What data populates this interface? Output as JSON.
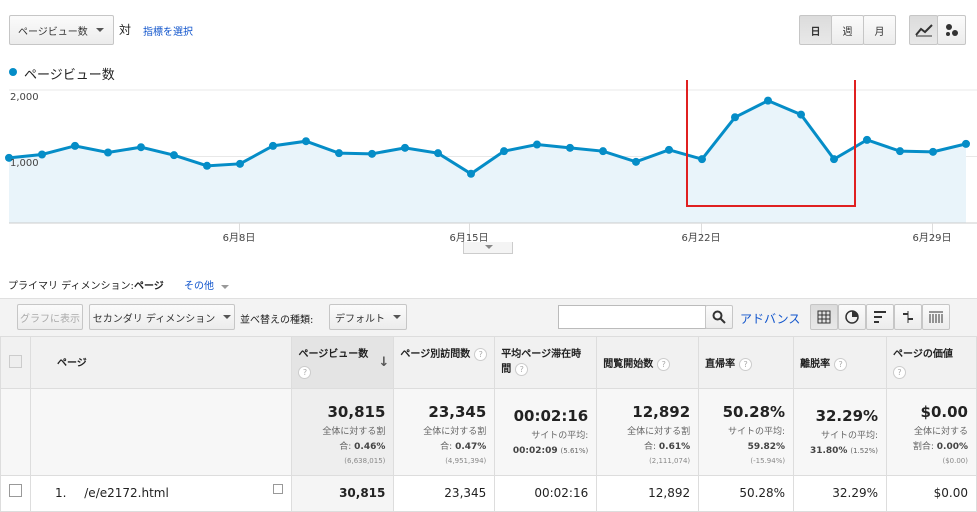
{
  "toolbar": {
    "metric_select": "ページビュー数",
    "vs_label": "対",
    "select_metric_link": "指標を選択",
    "period": {
      "day": "日",
      "week": "週",
      "month": "月"
    }
  },
  "legend": {
    "series": "ページビュー数",
    "color": "#058dc7"
  },
  "chart_data": {
    "type": "area",
    "title": "",
    "series": [
      {
        "name": "ページビュー数",
        "values": [
          980,
          1030,
          1160,
          1060,
          1140,
          1020,
          860,
          890,
          1160,
          1230,
          1050,
          1040,
          1130,
          1050,
          740,
          1080,
          1180,
          1130,
          1080,
          920,
          1100,
          960,
          1590,
          1840,
          1630,
          960,
          1250,
          1080,
          1070,
          1190
        ]
      }
    ],
    "ylim": [
      0,
      2000
    ],
    "y_ticks": [
      "2,000",
      "1,000"
    ],
    "x_ticks": [
      "6月8日",
      "6月15日",
      "6月22日",
      "6月29日"
    ],
    "grid": true,
    "highlight_label": "red box around peak"
  },
  "dimension": {
    "label": "プライマリ ディメンション:",
    "selected": "ページ",
    "other": "その他"
  },
  "controls": {
    "plot_rows": "グラフに表示",
    "secondary_dimension": "セカンダリ ディメンション",
    "sort_label": "並べ替えの種類:",
    "sort_value": "デフォルト",
    "search_placeholder": "",
    "advanced": "アドバンス"
  },
  "table": {
    "columns": {
      "page": "ページ",
      "pageviews": "ページビュー数",
      "unique": "ページ別訪問数",
      "avg_time": "平均ページ滞在時間",
      "entrances": "閲覧開始数",
      "bounce": "直帰率",
      "exit": "離脱率",
      "value": "ページの価値"
    },
    "totals": {
      "pageviews": {
        "value": "30,815",
        "line1": "全体に対する割",
        "line2a": "合:",
        "line2b": "0.46%",
        "tiny": "(6,638,015)"
      },
      "unique": {
        "value": "23,345",
        "line1": "全体に対する割",
        "line2a": "合:",
        "line2b": "0.47%",
        "tiny": "(4,951,394)"
      },
      "avg_time": {
        "value": "00:02:16",
        "line1": "サイトの平均:",
        "line2a": "00:02:09",
        "line2b": "(5.61%)"
      },
      "entrances": {
        "value": "12,892",
        "line1": "全体に対する割",
        "line2a": "合:",
        "line2b": "0.61%",
        "tiny": "(2,111,074)"
      },
      "bounce": {
        "value": "50.28%",
        "line1": "サイトの平均:",
        "line2a": "59.82%",
        "tiny": "(-15.94%)"
      },
      "exit": {
        "value": "32.29%",
        "line1": "サイトの平均:",
        "line2a": "31.80%",
        "line2b": "(1.52%)"
      },
      "value": {
        "value": "$0.00",
        "line1": "全体に対する",
        "line2a": "割合:",
        "line2b": "0.00%",
        "tiny": "($0.00)"
      }
    },
    "rows": [
      {
        "num": "1.",
        "page": "/e/e2172.html",
        "pageviews": "30,815",
        "unique": "23,345",
        "avg_time": "00:02:16",
        "entrances": "12,892",
        "bounce": "50.28%",
        "exit": "32.29%",
        "value": "$0.00"
      }
    ]
  }
}
